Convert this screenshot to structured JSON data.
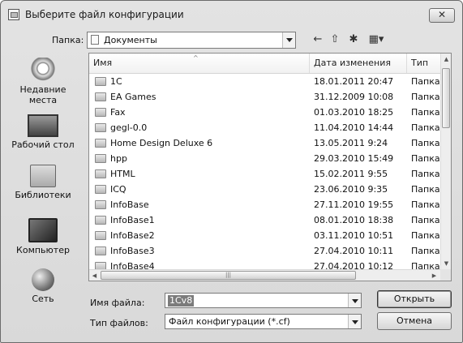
{
  "window": {
    "title": "Выберите файл конфигурации",
    "close_label": "✕"
  },
  "location": {
    "label": "Папка:",
    "value": "Документы"
  },
  "toolbar": {
    "back_glyph": "←",
    "up_glyph": "⇧",
    "newfolder_glyph": "✱",
    "view_glyph": "▦▾"
  },
  "places": [
    {
      "label": "Недавние места",
      "icon": "recent-places-icon"
    },
    {
      "label": "Рабочий стол",
      "icon": "desktop-icon"
    },
    {
      "label": "Библиотеки",
      "icon": "libraries-icon"
    },
    {
      "label": "Компьютер",
      "icon": "computer-icon"
    },
    {
      "label": "Сеть",
      "icon": "network-icon"
    }
  ],
  "filelist": {
    "columns": [
      "Имя",
      "Дата изменения",
      "Тип"
    ],
    "sort_caret": "^",
    "rows": [
      {
        "name": "1C",
        "date": "18.01.2011 20:47",
        "type": "Папка"
      },
      {
        "name": "EA Games",
        "date": "31.12.2009 10:08",
        "type": "Папка"
      },
      {
        "name": "Fax",
        "date": "01.03.2010 18:25",
        "type": "Папка"
      },
      {
        "name": "gegl-0.0",
        "date": "11.04.2010 14:44",
        "type": "Папка"
      },
      {
        "name": "Home Design Deluxe 6",
        "date": "13.05.2011 9:24",
        "type": "Папка"
      },
      {
        "name": "hpp",
        "date": "29.03.2010 15:49",
        "type": "Папка"
      },
      {
        "name": "HTML",
        "date": "15.02.2011 9:55",
        "type": "Папка"
      },
      {
        "name": "ICQ",
        "date": "23.06.2010 9:35",
        "type": "Папка"
      },
      {
        "name": "InfoBase",
        "date": "27.11.2010 19:55",
        "type": "Папка"
      },
      {
        "name": "InfoBase1",
        "date": "08.01.2010 18:38",
        "type": "Папка"
      },
      {
        "name": "InfoBase2",
        "date": "03.11.2010 10:51",
        "type": "Папка"
      },
      {
        "name": "InfoBase3",
        "date": "27.04.2010 10:11",
        "type": "Папка"
      },
      {
        "name": "InfoBase4",
        "date": "27.04.2010 10:12",
        "type": "Папка"
      }
    ]
  },
  "scroll": {
    "up": "▲",
    "down": "▼",
    "left": "◀",
    "right": "▶",
    "grip": "|||"
  },
  "filename": {
    "label": "Имя файла:",
    "value": "1Cv8"
  },
  "filetype": {
    "label": "Тип файлов:",
    "value": "Файл конфигурации (*.cf)"
  },
  "buttons": {
    "open": "Открыть",
    "cancel": "Отмена"
  }
}
